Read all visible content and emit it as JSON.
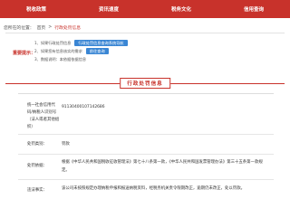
{
  "nav": {
    "items": [
      "税收政策",
      "资讯速度",
      "税务文化",
      "信用查询"
    ]
  },
  "breadcrumb": {
    "prefix": "您所在的位置：",
    "home": "首页",
    "sep": ">",
    "current": "行政处罚信息"
  },
  "notice": {
    "title": "重要提示：",
    "lines": [
      "1、如果行政处罚信息",
      "2、如果您有信息核实的需求",
      "3、数据说明：本依据依据信息"
    ],
    "tags": [
      "行政处罚信息查询系统导航",
      "前往查询"
    ]
  },
  "section": {
    "title": "行政处罚信息"
  },
  "record": {
    "code_label": "统一社会信用代码/纳税人识别号",
    "code_value": "91130400107142686",
    "code_label2": "（法人或者其他组织）",
    "type_label": "处罚类别：",
    "type_value": "罚款",
    "basis_label": "处罚依据：",
    "basis_value": "根据《中华人民共和国税收征收管理法》第七十八条第一款，《中华人民共和国发票管理办法》第三十五条第一款规定。",
    "detail_label": "违法事实：",
    "detail_value": "该公司未按照规定办理纳税申报和报送纳税资料，经税务机关责令限期改正，逾期仍未改正，处以罚款。"
  }
}
